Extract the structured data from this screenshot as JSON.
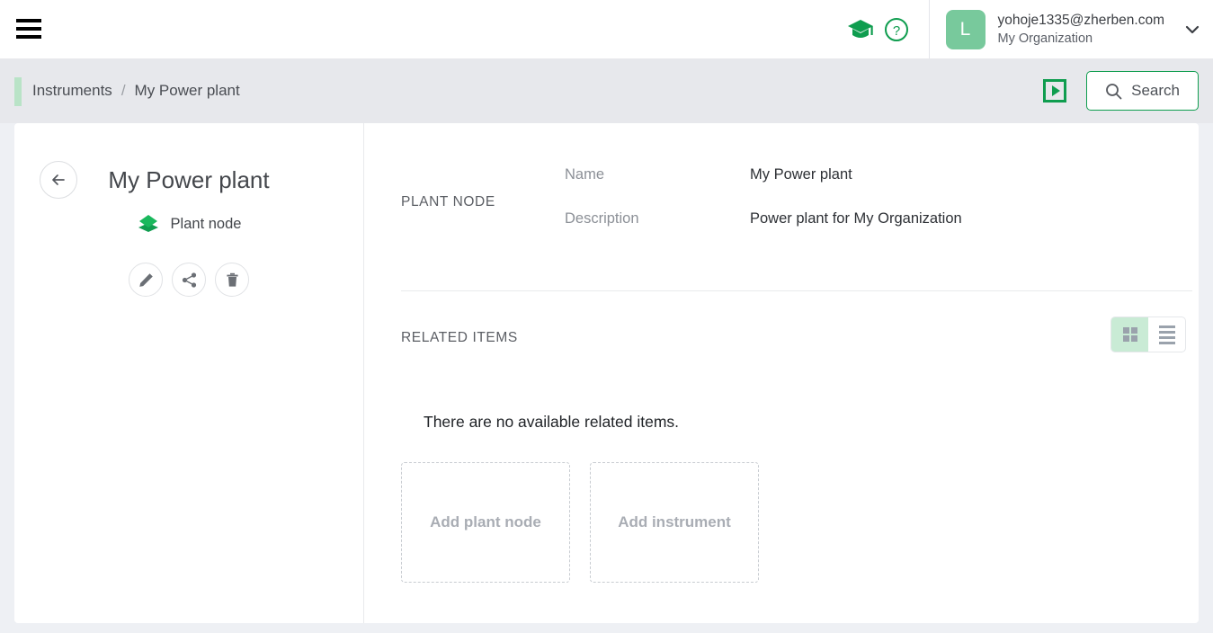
{
  "colors": {
    "brand_green": "#0f9d4f",
    "accent_light_green": "#b9e3c7",
    "avatar_green": "#78c99c",
    "page_bg": "#eef0f4",
    "crumbbar_bg": "#e7e8ec"
  },
  "topbar": {
    "menu_label": "Menu",
    "learning_icon": "graduation-cap-icon",
    "help_icon": "help-circle-icon",
    "account": {
      "avatar_initial": "L",
      "email": "yohoje1335@zherben.com",
      "organization": "My Organization",
      "chevron_icon": "chevron-down-icon"
    }
  },
  "breadcrumb": {
    "items": [
      {
        "label": "Instruments"
      },
      {
        "label": "My Power plant"
      }
    ],
    "separator": "/",
    "tour_icon": "play-square-icon",
    "search": {
      "label": "Search",
      "icon": "search-icon"
    }
  },
  "detail": {
    "back_icon": "arrow-left-icon",
    "title": "My Power plant",
    "type_label": "Plant node",
    "type_icon": "layers-icon",
    "actions": [
      {
        "name": "edit",
        "icon": "pencil-icon"
      },
      {
        "name": "share",
        "icon": "share-icon"
      },
      {
        "name": "delete",
        "icon": "trash-icon"
      }
    ]
  },
  "info": {
    "section_label": "PLANT NODE",
    "fields": [
      {
        "key": "Name",
        "value": "My Power plant"
      },
      {
        "key": "Description",
        "value": "Power plant for My Organization"
      }
    ]
  },
  "related": {
    "section_label": "RELATED ITEMS",
    "view_modes": [
      {
        "name": "grid",
        "icon": "grid-view-icon",
        "active": true
      },
      {
        "name": "list",
        "icon": "list-view-icon",
        "active": false
      }
    ],
    "empty_message": "There are no available related items.",
    "add_cards": [
      {
        "label": "Add plant node"
      },
      {
        "label": "Add instrument"
      }
    ]
  }
}
